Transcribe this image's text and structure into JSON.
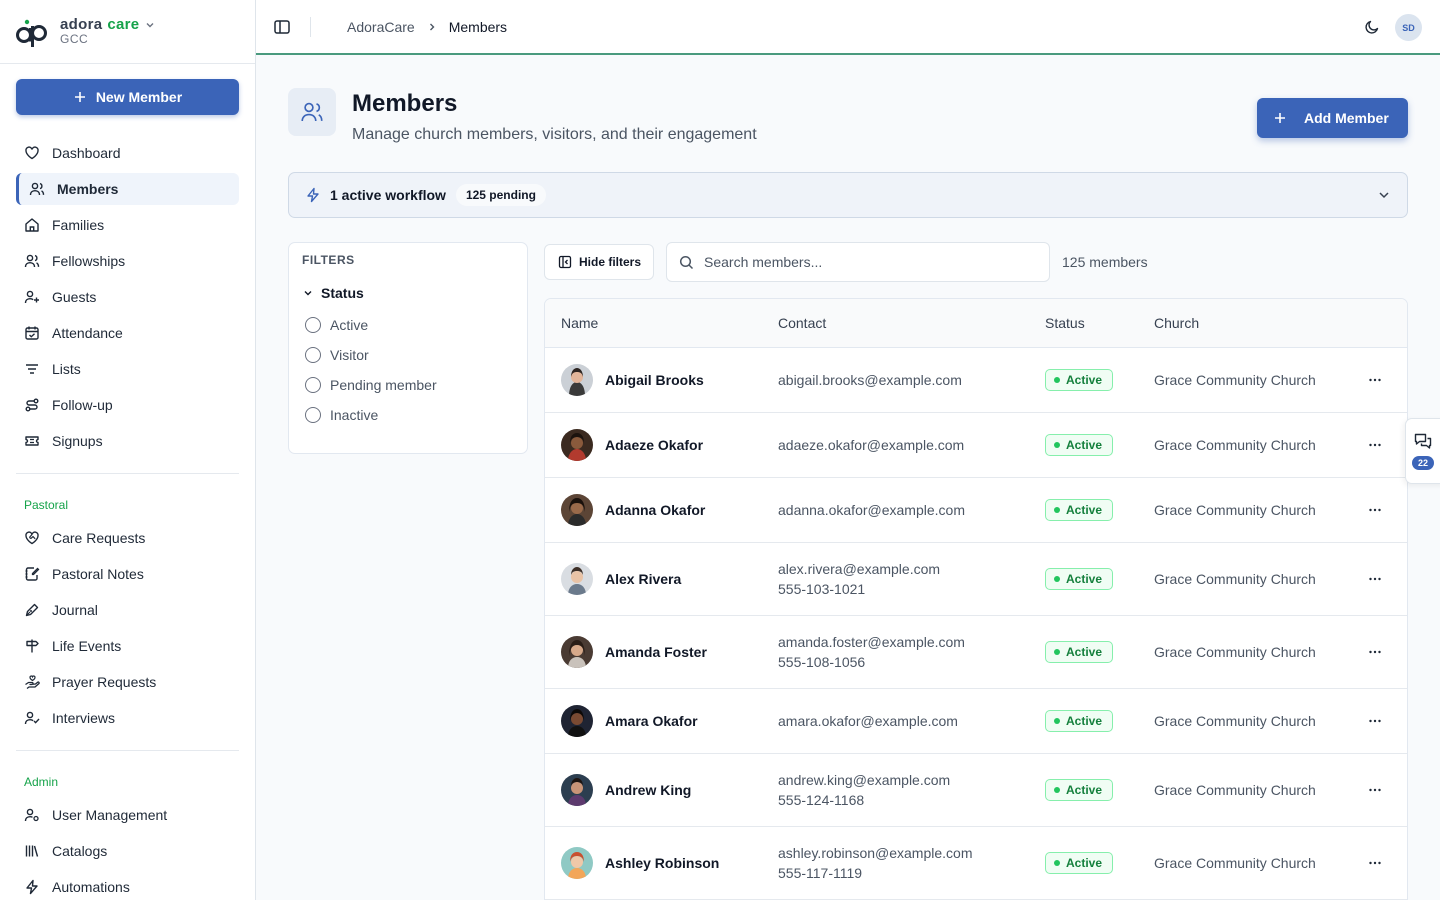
{
  "brand": {
    "name_main": "adora",
    "name_accent": "care",
    "org": "GCC"
  },
  "sidebar": {
    "new_button": "New Member",
    "items": [
      {
        "label": "Dashboard",
        "icon": "heart-icon"
      },
      {
        "label": "Members",
        "icon": "users-icon",
        "active": true
      },
      {
        "label": "Families",
        "icon": "home-icon"
      },
      {
        "label": "Fellowships",
        "icon": "users-icon"
      },
      {
        "label": "Guests",
        "icon": "user-plus-icon"
      },
      {
        "label": "Attendance",
        "icon": "calendar-check-icon"
      },
      {
        "label": "Lists",
        "icon": "list-filter-icon"
      },
      {
        "label": "Follow-up",
        "icon": "route-icon"
      },
      {
        "label": "Signups",
        "icon": "ticket-icon"
      }
    ],
    "pastoral_section": "Pastoral",
    "pastoral_items": [
      {
        "label": "Care Requests",
        "icon": "heart-handshake-icon"
      },
      {
        "label": "Pastoral Notes",
        "icon": "notebook-pen-icon"
      },
      {
        "label": "Journal",
        "icon": "pen-tool-icon"
      },
      {
        "label": "Life Events",
        "icon": "signpost-icon"
      },
      {
        "label": "Prayer Requests",
        "icon": "hand-heart-icon"
      },
      {
        "label": "Interviews",
        "icon": "user-check-icon"
      }
    ],
    "admin_section": "Admin",
    "admin_items": [
      {
        "label": "User Management",
        "icon": "user-cog-icon"
      },
      {
        "label": "Catalogs",
        "icon": "library-icon"
      },
      {
        "label": "Automations",
        "icon": "zap-icon"
      }
    ]
  },
  "topbar": {
    "breadcrumb": [
      "AdoraCare",
      "Members"
    ],
    "avatar_initials": "SD"
  },
  "header": {
    "title": "Members",
    "subtitle": "Manage church members, visitors, and their engagement",
    "add_button": "Add Member"
  },
  "workflow": {
    "text": "1 active workflow",
    "badge": "125 pending"
  },
  "filters": {
    "title": "FILTERS",
    "group": "Status",
    "options": [
      "Active",
      "Visitor",
      "Pending member",
      "Inactive"
    ]
  },
  "toolbar": {
    "hide_filters": "Hide filters",
    "search_placeholder": "Search members...",
    "count": "125 members"
  },
  "table": {
    "columns": [
      "Name",
      "Contact",
      "Status",
      "Church"
    ],
    "rows": [
      {
        "name": "Abigail Brooks",
        "email": "abigail.brooks@example.com",
        "phone": "",
        "status": "Active",
        "church": "Grace Community Church"
      },
      {
        "name": "Adaeze Okafor",
        "email": "adaeze.okafor@example.com",
        "phone": "",
        "status": "Active",
        "church": "Grace Community Church"
      },
      {
        "name": "Adanna Okafor",
        "email": "adanna.okafor@example.com",
        "phone": "",
        "status": "Active",
        "church": "Grace Community Church"
      },
      {
        "name": "Alex Rivera",
        "email": "alex.rivera@example.com",
        "phone": "555-103-1021",
        "status": "Active",
        "church": "Grace Community Church"
      },
      {
        "name": "Amanda Foster",
        "email": "amanda.foster@example.com",
        "phone": "555-108-1056",
        "status": "Active",
        "church": "Grace Community Church"
      },
      {
        "name": "Amara Okafor",
        "email": "amara.okafor@example.com",
        "phone": "",
        "status": "Active",
        "church": "Grace Community Church"
      },
      {
        "name": "Andrew King",
        "email": "andrew.king@example.com",
        "phone": "555-124-1168",
        "status": "Active",
        "church": "Grace Community Church"
      },
      {
        "name": "Ashley Robinson",
        "email": "ashley.robinson@example.com",
        "phone": "555-117-1119",
        "status": "Active",
        "church": "Grace Community Church"
      }
    ]
  },
  "chat_widget": {
    "count": "22"
  },
  "colors": {
    "primary": "#3b64b8",
    "accent_green": "#16a34a",
    "active_badge": "#15803d"
  }
}
